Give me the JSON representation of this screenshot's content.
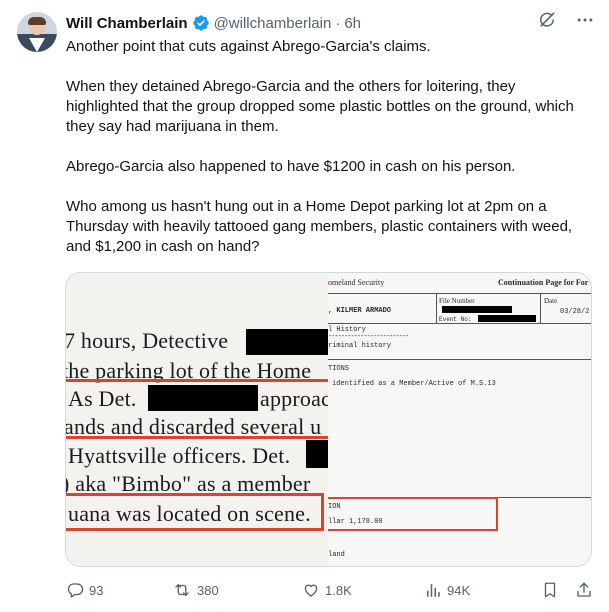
{
  "author": {
    "display_name": "Will Chamberlain",
    "handle": "@willchamberlain",
    "separator": "·",
    "time": "6h"
  },
  "tweet": {
    "paragraphs": [
      "Another point that cuts against Abrego-Garcia's claims.",
      "When they detained Abrego-Garcia and the others for loitering, they highlighted that the group dropped some plastic bottles on the ground, which they say had marijuana in them.",
      "Abrego-Garcia also happened to have $1200 in cash on his person.",
      "Who among us hasn't hung out in a Home Depot parking lot at 2pm on a Thursday with heavily tattooed gang members, plastic containers with weed, and $1,200 in cash on hand?"
    ]
  },
  "media": {
    "left_doc": {
      "lines": [
        "7 hours, Detective",
        "the parking lot of the Home",
        "As Det.",
        "approac",
        "ands and discarded several u",
        "Hyattsville officers. Det.",
        ") aka \"Bimbo\" as a member",
        "uana was located on scene."
      ]
    },
    "right_doc": {
      "agency": "omeland Security",
      "continuation": "Continuation Page for For",
      "name": ", KILMER ARMADO",
      "file_number_label": "File Number",
      "event_no_label": "Event No:",
      "date_label": "Date",
      "date_value": "03/28/2",
      "history_header": "l History",
      "history_value": "riminal history",
      "section_header": "TIONS",
      "identified_text": "identified as a Member/Active of M.S.13",
      "ion_header": "ION",
      "cash_text": "llar 1,178.00",
      "footer_text": "land"
    }
  },
  "actions": {
    "replies": "93",
    "reposts": "380",
    "likes": "1.8K",
    "views": "94K"
  },
  "colors": {
    "text_primary": "#0f1419",
    "text_secondary": "#536471",
    "verified_blue": "#1d9bf0",
    "annotation_red": "#d9442c",
    "border": "#cfd9de"
  },
  "icons": [
    "verified-badge-icon",
    "grok-icon",
    "more-icon",
    "reply-icon",
    "repost-icon",
    "like-icon",
    "views-icon",
    "bookmark-icon",
    "share-icon"
  ]
}
